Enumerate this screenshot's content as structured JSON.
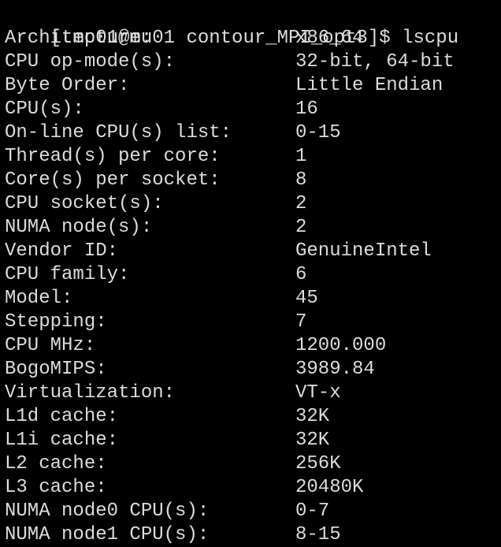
{
  "terminal": {
    "prompt": "[tmp01@mu01 contour_MPI_opt3]$ lscpu",
    "rows": [
      {
        "key": "Architecture:",
        "value": "x86_64"
      },
      {
        "key": "CPU op-mode(s):",
        "value": "32-bit, 64-bit"
      },
      {
        "key": "Byte Order:",
        "value": "Little Endian"
      },
      {
        "key": "CPU(s):",
        "value": "16"
      },
      {
        "key": "On-line CPU(s) list:",
        "value": "0-15"
      },
      {
        "key": "Thread(s) per core:",
        "value": "1"
      },
      {
        "key": "Core(s) per socket:",
        "value": "8"
      },
      {
        "key": "CPU socket(s):",
        "value": "2"
      },
      {
        "key": "NUMA node(s):",
        "value": "2"
      },
      {
        "key": "Vendor ID:",
        "value": "GenuineIntel"
      },
      {
        "key": "CPU family:",
        "value": "6"
      },
      {
        "key": "Model:",
        "value": "45"
      },
      {
        "key": "Stepping:",
        "value": "7"
      },
      {
        "key": "CPU MHz:",
        "value": "1200.000"
      },
      {
        "key": "BogoMIPS:",
        "value": "3989.84"
      },
      {
        "key": "Virtualization:",
        "value": "VT-x"
      },
      {
        "key": "L1d cache:",
        "value": "32K"
      },
      {
        "key": "L1i cache:",
        "value": "32K"
      },
      {
        "key": "L2 cache:",
        "value": "256K"
      },
      {
        "key": "L3 cache:",
        "value": "20480K"
      },
      {
        "key": "NUMA node0 CPU(s):",
        "value": "0-7"
      },
      {
        "key": "NUMA node1 CPU(s):",
        "value": "8-15"
      }
    ]
  },
  "colors": {
    "background": "#000000",
    "text": "#dcdcdc"
  }
}
